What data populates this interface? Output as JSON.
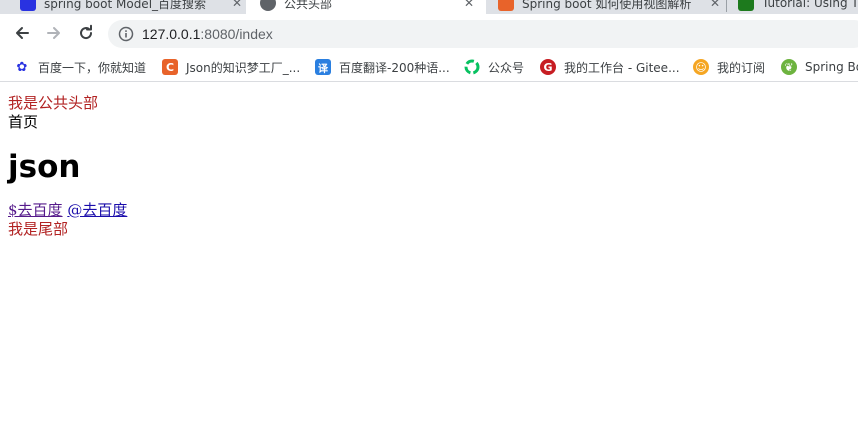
{
  "tabs": [
    {
      "title": "spring boot Model_百度搜索",
      "favicon": "paw-favicon",
      "color": "#2932e1"
    },
    {
      "title": "公共头部",
      "favicon": "globe-favicon",
      "color": "#5f6368",
      "active": true
    },
    {
      "title": "Spring boot 如何使用视图解析",
      "favicon": "csdn-favicon",
      "color": "#e8632a"
    },
    {
      "title": "Tutorial: Using Th",
      "favicon": "green-favicon",
      "color": "#1d7a1d"
    }
  ],
  "address_bar": {
    "host": "127.0.0.1",
    "path": ":8080/index"
  },
  "bookmarks": [
    {
      "label": "百度一下，你就知道",
      "icon": "paw-icon",
      "color": "#2932e1",
      "glyph": "🐾"
    },
    {
      "label": "Json的知识梦工厂_...",
      "icon": "csdn-icon",
      "color": "#e8632a",
      "glyph": "C"
    },
    {
      "label": "百度翻译-200种语...",
      "icon": "translate-icon",
      "color": "#2a7fe0",
      "glyph": "译"
    },
    {
      "label": "公众号",
      "icon": "wechat-icon",
      "color": "#07c160",
      "glyph": ""
    },
    {
      "label": "我的工作台 - Gitee...",
      "icon": "gitee-icon",
      "color": "#c71d23",
      "glyph": "G"
    },
    {
      "label": "我的订阅",
      "icon": "subscribe-icon",
      "color": "#f5a623",
      "glyph": ""
    },
    {
      "label": "Spring Bo",
      "icon": "spring-icon",
      "color": "#6db33f",
      "glyph": ""
    }
  ],
  "page": {
    "header_text": "我是公共头部",
    "home_text": "首页",
    "title": "json",
    "link_dollar": "$去百度",
    "link_at": "@去百度",
    "footer_text": "我是尾部"
  }
}
